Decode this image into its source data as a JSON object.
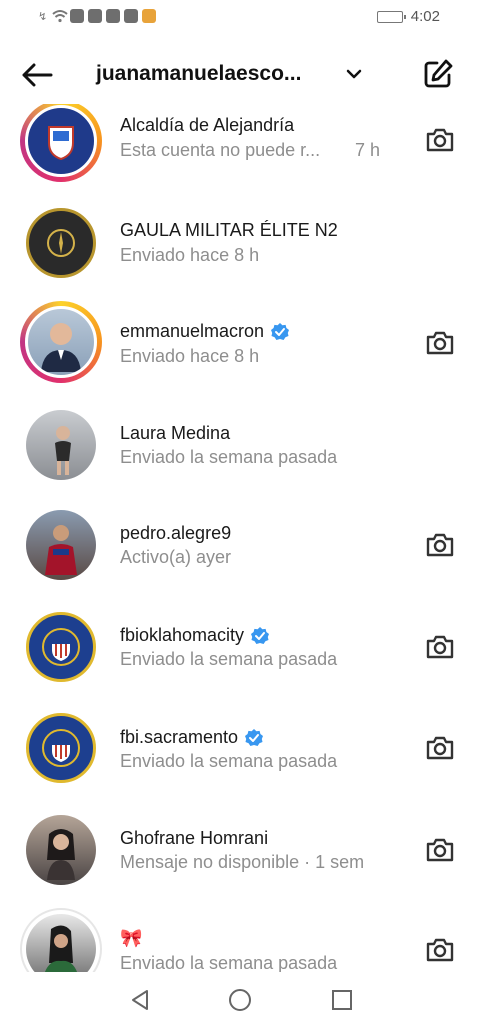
{
  "status_bar": {
    "time": "4:02",
    "icons": [
      "notification-icon",
      "wifi-icon",
      "app-icon",
      "app-icon",
      "app-icon",
      "app-icon",
      "app-icon"
    ]
  },
  "header": {
    "account_name": "juanamanuelaesco...",
    "back_icon": "arrow-left-icon",
    "dropdown_icon": "chevron-down-icon",
    "compose_icon": "compose-icon"
  },
  "threads": [
    {
      "name": "Alcaldía de Alejandría",
      "subtitle": "Esta cuenta no puede r...",
      "time": "7 h",
      "verified": false,
      "story": true,
      "camera": true,
      "avatar_color": "#1f3a8a"
    },
    {
      "name": "GAULA MILITAR ÉLITE N2",
      "subtitle": "Enviado hace 8 h",
      "time": "",
      "verified": false,
      "story": false,
      "camera": false,
      "avatar_color": "#2a2a2a"
    },
    {
      "name": "emmanuelmacron",
      "subtitle": "Enviado hace 8 h",
      "time": "",
      "verified": true,
      "story": true,
      "camera": true,
      "avatar_color": "#8aa0b8"
    },
    {
      "name": "Laura Medina",
      "subtitle": "Enviado la semana pasada",
      "time": "",
      "verified": false,
      "story": false,
      "camera": false,
      "avatar_color": "#9a9a9a"
    },
    {
      "name": "pedro.alegre9",
      "subtitle": "Activo(a) ayer",
      "time": "",
      "verified": false,
      "story": false,
      "camera": true,
      "avatar_color": "#7a4a3a"
    },
    {
      "name": "fbioklahomacity",
      "subtitle": "Enviado la semana pasada",
      "time": "",
      "verified": true,
      "story": false,
      "camera": true,
      "avatar_color": "#1d3f8f"
    },
    {
      "name": "fbi.sacramento",
      "subtitle": "Enviado la semana pasada",
      "time": "",
      "verified": true,
      "story": false,
      "camera": true,
      "avatar_color": "#1d3f8f"
    },
    {
      "name": "Ghofrane Homrani",
      "subtitle": "Mensaje no disponible · 1 sem",
      "time": "",
      "verified": false,
      "story": false,
      "camera": true,
      "avatar_color": "#5a5a5a"
    },
    {
      "name": "🎀",
      "subtitle": "Enviado la semana pasada",
      "time": "",
      "verified": false,
      "story": false,
      "camera": true,
      "avatar_color": "#6b6b6b"
    }
  ],
  "navbar": {
    "icons": [
      "back-triangle-icon",
      "home-circle-icon",
      "recents-square-icon"
    ]
  },
  "colors": {
    "verified_blue": "#3897f0",
    "text_primary": "#1a1a1a",
    "text_secondary": "#8e8e8e"
  }
}
